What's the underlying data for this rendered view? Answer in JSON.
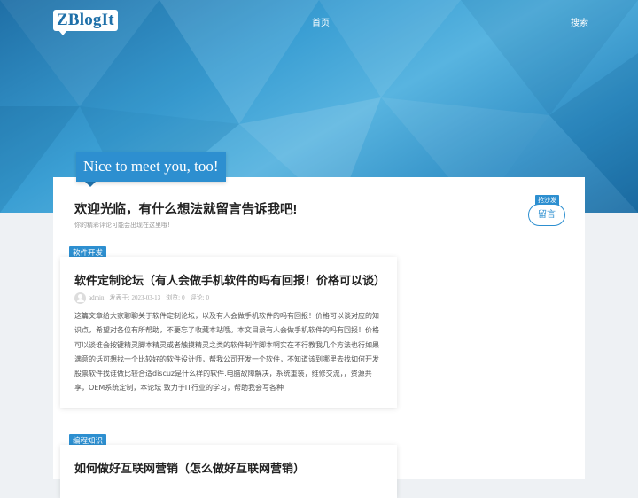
{
  "site": {
    "logo": "ZBlogIt"
  },
  "nav": {
    "home": "首页",
    "search": "搜索"
  },
  "banner": {
    "text": "Nice to meet you, too!"
  },
  "welcome": {
    "title": "欢迎光临，有什么想法就留言告诉我吧!",
    "subtitle": "你的精彩评论可能会出现在这里哦!"
  },
  "guestbook": {
    "tag": "抢沙发",
    "button": "留言"
  },
  "posts": [
    {
      "category": "软件开发",
      "title": "软件定制论坛（有人会做手机软件的吗有回报！价格可以谈）",
      "author": "admin",
      "posted_label": "发表于:",
      "date": "2023-03-13",
      "views_label": "浏览:",
      "views": "0",
      "comments_label": "评论:",
      "comments": "0",
      "excerpt": "这篇文章给大家聊聊关于软件定制论坛，以及有人会做手机软件的吗有回报！价格可以谈对应的知识点，希望对各位有所帮助，不要忘了收藏本站哦。本文目录有人会做手机软件的吗有回报！价格可以谈谁会按键精灵脚本精灵或者触摸精灵之类的软件制作脚本啊实在不行教我几个方法也行如果满意的话可想找一个比较好的软件设计师，帮我公司开发一个软件，不知道该到哪里去找如何开发股票软件找谁做比较合适discuz是什么样的软件.电脑故障解决，系统重装，维修交流，，资源共享，OEM系统定制，本论坛 致力于IT行业的学习，帮助我会写各种"
    },
    {
      "category": "编程知识",
      "title": "如何做好互联网营销（怎么做好互联网营销）"
    }
  ]
}
